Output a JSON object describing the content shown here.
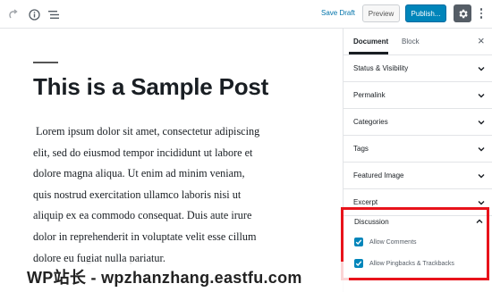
{
  "toolbar": {
    "save_draft": "Save Draft",
    "preview": "Preview",
    "publish": "Publish...",
    "icons": [
      "redo-icon",
      "info-icon",
      "outline-icon",
      "gear-icon",
      "more-vertical-icon"
    ]
  },
  "post": {
    "title": "This is a Sample Post",
    "body_lines": [
      "Lorem ipsum dolor sit amet, consectetur adipiscing",
      "elit, sed do eiusmod tempor incididunt ut labore et",
      "dolore magna aliqua. Ut enim ad minim veniam,",
      "quis nostrud exercitation ullamco laboris nisi ut",
      "aliquip ex ea commodo consequat. Duis aute irure",
      "dolor in reprehenderit in voluptate velit esse cillum",
      "dolore eu fugiat nulla pariatur."
    ]
  },
  "sidebar": {
    "tabs": [
      "Document",
      "Block"
    ],
    "active_tab": "Document",
    "close": "×",
    "panels": [
      "Status & Visibility",
      "Permalink",
      "Categories",
      "Tags",
      "Featured Image",
      "Excerpt"
    ],
    "discussion": {
      "title": "Discussion",
      "options": [
        {
          "label": "Allow Comments",
          "checked": true
        },
        {
          "label": "Allow Pingbacks & Trackbacks",
          "checked": true
        }
      ]
    }
  },
  "colors": {
    "accent": "#0085ba",
    "link": "#0073aa",
    "highlight_border": "#e8131b"
  },
  "watermark": "WP站长 - wpzhanzhang.eastfu.com"
}
